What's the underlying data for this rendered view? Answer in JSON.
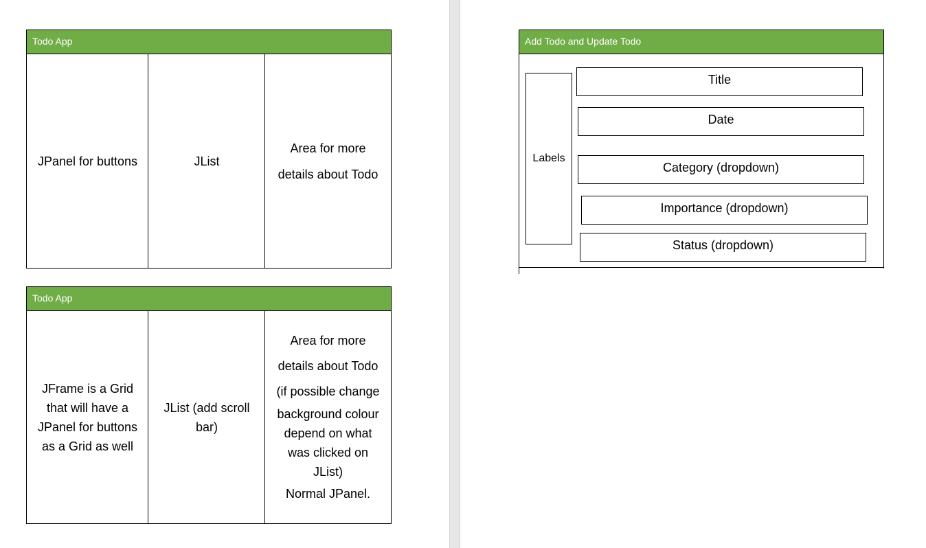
{
  "window1": {
    "title": "Todo App",
    "col1": "JPanel for buttons",
    "col2": "JList",
    "col3_lines": [
      "Area for more",
      "details about Todo"
    ]
  },
  "window2": {
    "title": "Todo App",
    "col1_lines": [
      "JFrame is a Grid",
      "that will have a",
      "JPanel for buttons",
      "as a Grid as well"
    ],
    "col2_lines": [
      "JList (add scroll",
      "bar)"
    ],
    "col3_lines": [
      "Area for more",
      "details about Todo",
      "(if possible change",
      "background colour",
      "depend on what",
      "was clicked on",
      "JList)",
      "Normal JPanel."
    ]
  },
  "window3": {
    "title": "Add Todo and Update Todo",
    "labels": "Labels",
    "fields": [
      "Title",
      "Date",
      "Category (dropdown)",
      "Importance (dropdown)",
      "Status (dropdown)"
    ]
  },
  "colors": {
    "header_green": "#70ad47",
    "border": "#000000",
    "page_gap": "#e6e6e6"
  }
}
